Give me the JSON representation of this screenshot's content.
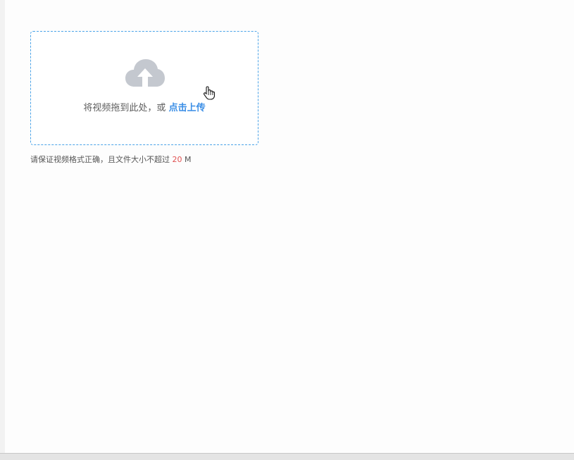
{
  "upload": {
    "drag_text": "将视频拖到此处，或 ",
    "click_link": "点击上传",
    "icon": "cloud-upload-icon",
    "border_color": "#4aa3e8",
    "link_color": "#3a8ee6"
  },
  "tip": {
    "prefix": "请保证视频格式正确，且文件大小不超过 ",
    "limit": "20",
    "unit": " M",
    "limit_color": "#e05151"
  }
}
